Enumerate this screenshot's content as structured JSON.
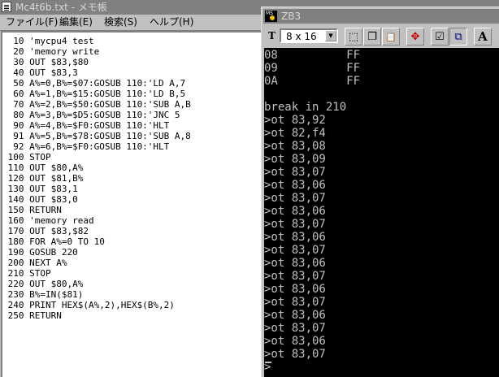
{
  "notepad": {
    "title": "Mc4t6b.txt - メモ帳",
    "menu": [
      {
        "label": "ファイル(F)"
      },
      {
        "label": "編集(E)"
      },
      {
        "label": "検索(S)"
      },
      {
        "label": "ヘルプ(H)"
      }
    ],
    "lines": [
      "  10 'mycpu4 test",
      "  20 'memory write",
      "  30 OUT $83,$80",
      "  40 OUT $83,3",
      "  50 A%=0,B%=$07:GOSUB 110:'LD A,7",
      "  60 A%=1,B%=$15:GOSUB 110:'LD B,5",
      "  70 A%=2,B%=$50:GOSUB 110:'SUB A,B",
      "  80 A%=3,B%=$D5:GOSUB 110:'JNC 5",
      "  90 A%=4,B%=$F0:GOSUB 110:'HLT",
      "  91 A%=5,B%=$78:GOSUB 110:'SUB A,8",
      "  92 A%=6,B%=$F0:GOSUB 110:'HLT",
      " 100 STOP",
      " 110 OUT $80,A%",
      " 120 OUT $81,B%",
      " 130 OUT $83,1",
      " 140 OUT $83,0",
      " 150 RETURN",
      " 160 'memory read",
      " 170 OUT $83,$82",
      " 180 FOR A%=0 TO 10",
      " 190 GOSUB 220",
      " 200 NEXT A%",
      " 210 STOP",
      " 220 OUT $80,A%",
      " 230 B%=IN($81)",
      " 240 PRINT HEX$(A%,2),HEX$(B%,2)",
      " 250 RETURN"
    ]
  },
  "console": {
    "title": "ZB3",
    "toolbar": {
      "font_icon": "T",
      "font_size": "8 x 16",
      "dropdown_arrow": "▼",
      "buttons": [
        {
          "name": "mark-icon",
          "glyph": "⬚"
        },
        {
          "name": "copy-icon",
          "glyph": "❐"
        },
        {
          "name": "paste-icon",
          "glyph": "📋"
        },
        {
          "name": "fullscreen-icon",
          "glyph": "✥"
        },
        {
          "name": "properties-icon",
          "glyph": "☑"
        },
        {
          "name": "background-icon",
          "glyph": "⧉"
        },
        {
          "name": "font-icon",
          "glyph": "A"
        }
      ]
    },
    "lines": [
      "08          FF",
      "09          FF",
      "0A          FF",
      "",
      "break in 210",
      ">ot 83,92",
      ">ot 82,f4",
      ">ot 83,08",
      ">ot 83,09",
      ">ot 83,07",
      ">ot 83,06",
      ">ot 83,07",
      ">ot 83,06",
      ">ot 83,07",
      ">ot 83,06",
      ">ot 83,07",
      ">ot 83,06",
      ">ot 83,07",
      ">ot 83,06",
      ">ot 83,07",
      ">ot 83,06",
      ">ot 83,07",
      ">ot 83,06",
      ">ot 83,07",
      ">"
    ]
  }
}
